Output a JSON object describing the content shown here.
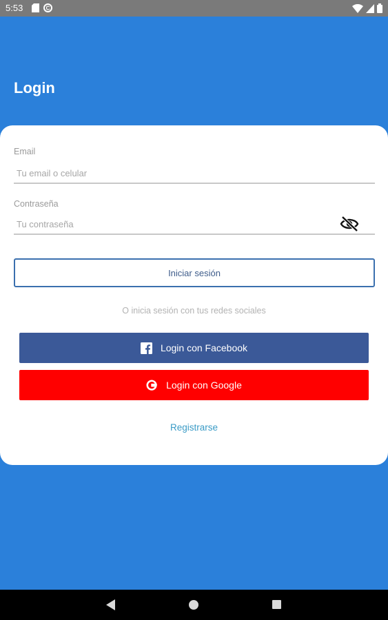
{
  "status_bar": {
    "time": "5:53",
    "icons": [
      "sd-card-icon",
      "sync-icon",
      "wifi-icon",
      "signal-icon",
      "battery-icon"
    ]
  },
  "header": {
    "title": "Login"
  },
  "form": {
    "email": {
      "label": "Email",
      "placeholder": "Tu email o celular",
      "value": ""
    },
    "password": {
      "label": "Contraseña",
      "placeholder": "Tu contraseña",
      "value": "",
      "toggle_icon": "eye-off-icon"
    },
    "login_button": "Iniciar sesión",
    "social_caption": "O inicia sesión con tus redes sociales",
    "facebook_button": {
      "label": "Login con Facebook",
      "icon": "facebook-icon",
      "color": "#3b5998"
    },
    "google_button": {
      "label": "Login con Google",
      "icon": "google-icon",
      "color": "#ff0000"
    },
    "register_link": "Registrarse"
  },
  "theme": {
    "background": "#2b80da",
    "card": "#ffffff",
    "accent_border": "#3a6fae",
    "link": "#3a9bc6"
  },
  "nav_bar": {
    "buttons": [
      "back-icon",
      "home-icon",
      "recents-icon"
    ]
  }
}
